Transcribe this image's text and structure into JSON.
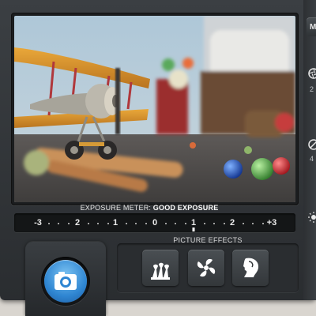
{
  "app": {
    "accent_color": "#3a8fd9",
    "body_color": "#33373a"
  },
  "rail": {
    "top_button_label": "M",
    "tick_1": "2",
    "tick_2": "4",
    "icons": [
      "aperture-icon",
      "focus-icon",
      "brightness-icon"
    ]
  },
  "viewfinder": {
    "image_subject": "toy airplane with marbles and pencils on a table"
  },
  "exposure_meter": {
    "label_prefix": "EXPOSURE METER:",
    "label_value": "GOOD EXPOSURE",
    "scale": [
      "-3",
      "2",
      "1",
      "0",
      "1",
      "2",
      "+3"
    ],
    "current_value": 0
  },
  "shutter": {
    "icon": "camera-icon"
  },
  "effects": {
    "title": "PICTURE EFFECTS",
    "items": [
      {
        "name": "chess-pieces-effect",
        "icon": "chess-pieces-icon"
      },
      {
        "name": "fan-effect",
        "icon": "fan-icon"
      },
      {
        "name": "portrait-effect",
        "icon": "face-profile-icon"
      }
    ]
  }
}
